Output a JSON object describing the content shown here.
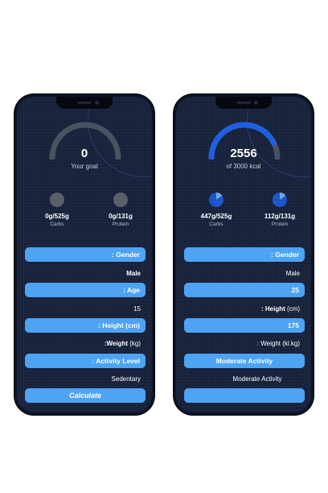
{
  "colors": {
    "accent": "#4ea3f3",
    "gauge_active": "#1f5fe0",
    "gauge_inactive": "#4a5160",
    "background": "#17213a"
  },
  "left_phone": {
    "gauge": {
      "value": "0",
      "caption": "Your goal",
      "progress": 0
    },
    "macros": [
      {
        "value": "0g/525g",
        "label": "Carbs",
        "fill": 0
      },
      {
        "value": "0g/131g",
        "label": "Protein",
        "fill": 0
      }
    ],
    "form": {
      "gender_label": ": Gender",
      "gender_value": "Male",
      "age_label": ": Age",
      "age_value": "15",
      "height_label": ": Height (cm)",
      "weight_label": ":Weight",
      "weight_unit": " (kg)",
      "activity_label": ": Activity Level",
      "activity_value": "Sedentary",
      "calculate_label": "Calculate"
    }
  },
  "right_phone": {
    "gauge": {
      "value": "2556",
      "caption": "of 3000 kcal",
      "progress": 0.852
    },
    "macros": [
      {
        "value": "447g/525g",
        "label": "Carbs",
        "fill": 0.85
      },
      {
        "value": "112g/131g",
        "label": "Protein",
        "fill": 0.85
      }
    ],
    "form": {
      "gender_label": ": Gender",
      "gender_value": "Male",
      "age_value": "25",
      "height_label": ": Height",
      "height_unit": " (cm)",
      "height_value": "175",
      "weight_label": ": Weight (kl.kg)",
      "activity_button": "Moderate Activity",
      "activity_value": "Moderate Activity",
      "calculate_label": ""
    }
  }
}
